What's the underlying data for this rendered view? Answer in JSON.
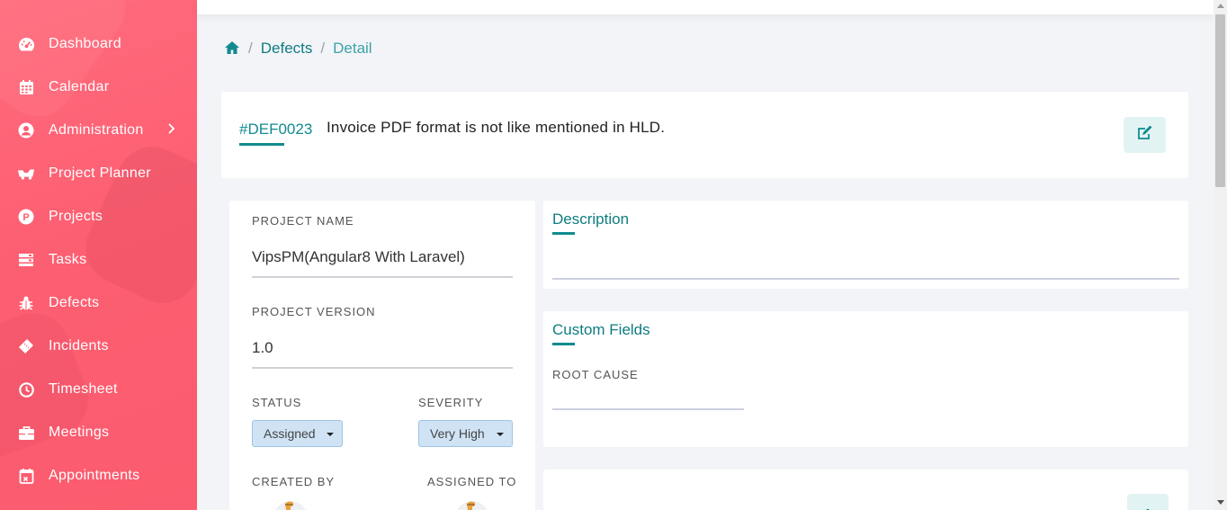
{
  "sidebar": {
    "items": [
      {
        "label": "Dashboard",
        "icon": "dashboard-icon"
      },
      {
        "label": "Calendar",
        "icon": "calendar-icon"
      },
      {
        "label": "Administration",
        "icon": "user-circle-icon",
        "has_submenu": true
      },
      {
        "label": "Project Planner",
        "icon": "project-planner-icon"
      },
      {
        "label": "Projects",
        "icon": "projects-icon"
      },
      {
        "label": "Tasks",
        "icon": "tasks-icon"
      },
      {
        "label": "Defects",
        "icon": "bug-icon"
      },
      {
        "label": "Incidents",
        "icon": "ticket-icon"
      },
      {
        "label": "Timesheet",
        "icon": "clock-icon"
      },
      {
        "label": "Meetings",
        "icon": "briefcase-icon"
      },
      {
        "label": "Appointments",
        "icon": "calendar-check-icon"
      }
    ]
  },
  "breadcrumb": {
    "home_icon": "home-icon",
    "separator": "/",
    "items": [
      "Defects",
      "Detail"
    ]
  },
  "defect": {
    "id": "#DEF0023",
    "title": "Invoice PDF format is not like mentioned in HLD.",
    "edit_icon": "edit-icon"
  },
  "details": {
    "project_name_label": "PROJECT NAME",
    "project_name": "VipsPM(Angular8 With Laravel)",
    "project_version_label": "PROJECT VERSION",
    "project_version": "1.0",
    "status_label": "STATUS",
    "status_value": "Assigned",
    "severity_label": "SEVERITY",
    "severity_value": "Very High",
    "created_by_label": "CREATED BY",
    "assigned_to_label": "ASSIGNED TO"
  },
  "description": {
    "title": "Description"
  },
  "custom_fields": {
    "title": "Custom Fields",
    "root_cause_label": "ROOT CAUSE"
  },
  "third_card": {
    "add_icon": "plus-icon"
  },
  "colors": {
    "sidebar": "#fd5f72",
    "accent": "#118b8f",
    "dropdown_bg": "#cfe3f5"
  }
}
